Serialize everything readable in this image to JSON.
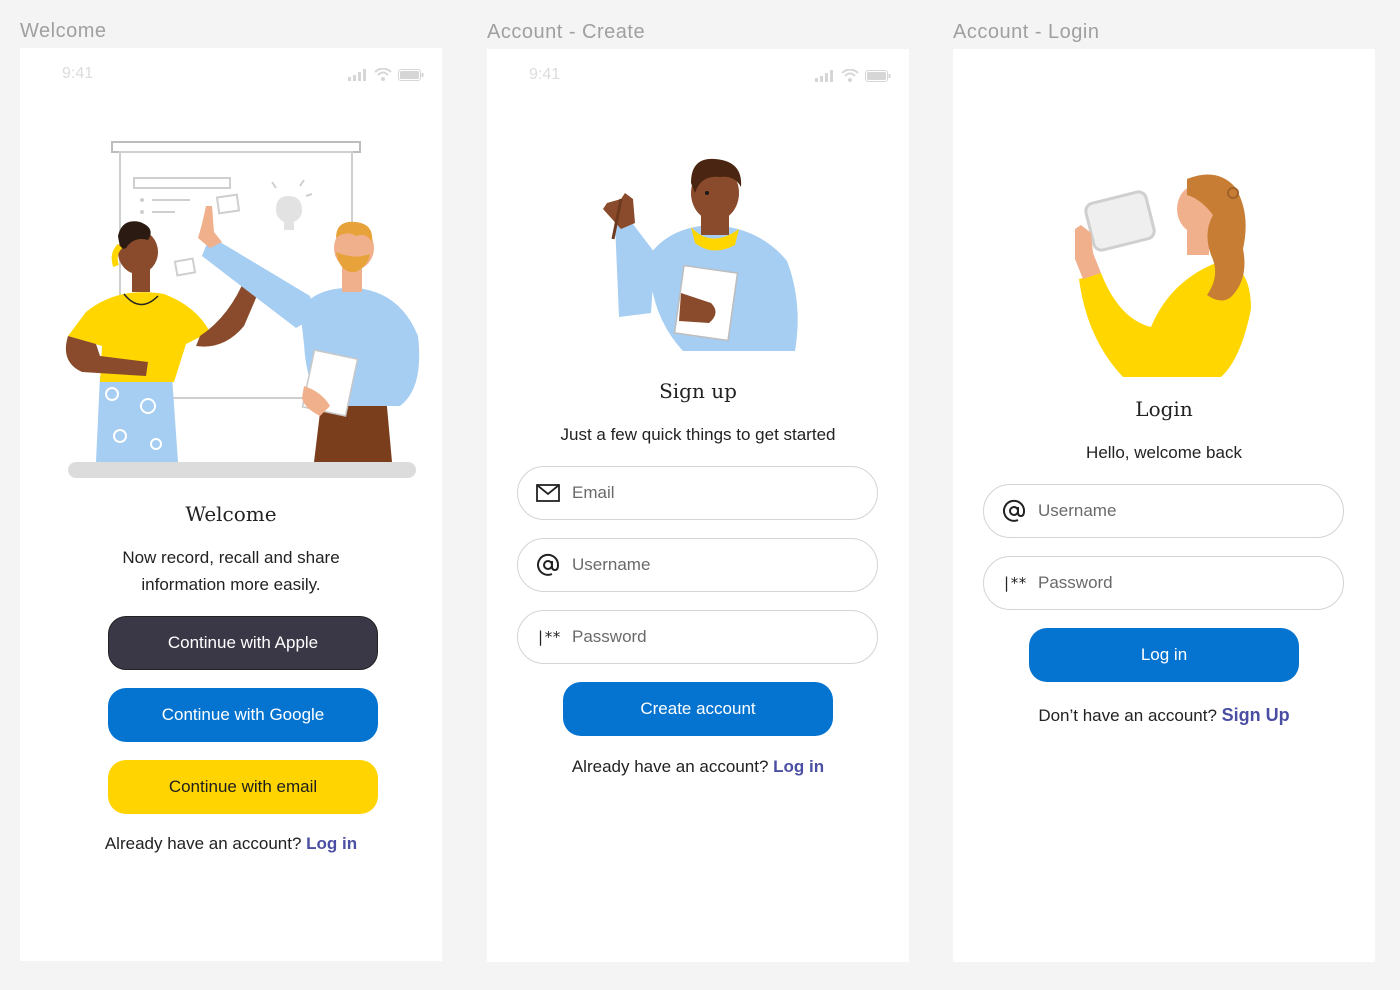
{
  "welcome": {
    "frame_label": "Welcome",
    "status_time": "9:41",
    "title": "Welcome",
    "subtitle_line1": "Now record, recall and share",
    "subtitle_line2": "information more easily.",
    "apple_label": "Continue with Apple",
    "google_label": "Continue with Google",
    "email_label": "Continue with email",
    "footer_text": "Already have an account? ",
    "footer_link": "Log in"
  },
  "create": {
    "frame_label": "Account - Create",
    "status_time": "9:41",
    "title": "Sign up",
    "subtitle": "Just a few quick things to get started",
    "email_placeholder": "Email",
    "username_placeholder": "Username",
    "password_placeholder": "Password",
    "password_icon": "|**",
    "button_label": "Create account",
    "footer_text": "Already have an account? ",
    "footer_link": "Log in"
  },
  "login": {
    "frame_label": "Account - Login",
    "title": "Login",
    "subtitle": "Hello, welcome back",
    "username_placeholder": "Username",
    "password_placeholder": "Password",
    "password_icon": "|**",
    "button_label": "Log in",
    "footer_text": "Don’t have an account? ",
    "footer_link": "Sign Up"
  },
  "colors": {
    "primary_blue": "#0574d1",
    "dark_button": "#3a3746",
    "yellow_button": "#ffd400",
    "link": "#4b4fa3"
  },
  "icons": {
    "email_field": "envelope-icon",
    "username_field": "at-sign-icon",
    "password_field": "password-icon",
    "status": [
      "signal-icon",
      "wifi-icon",
      "battery-icon"
    ]
  }
}
